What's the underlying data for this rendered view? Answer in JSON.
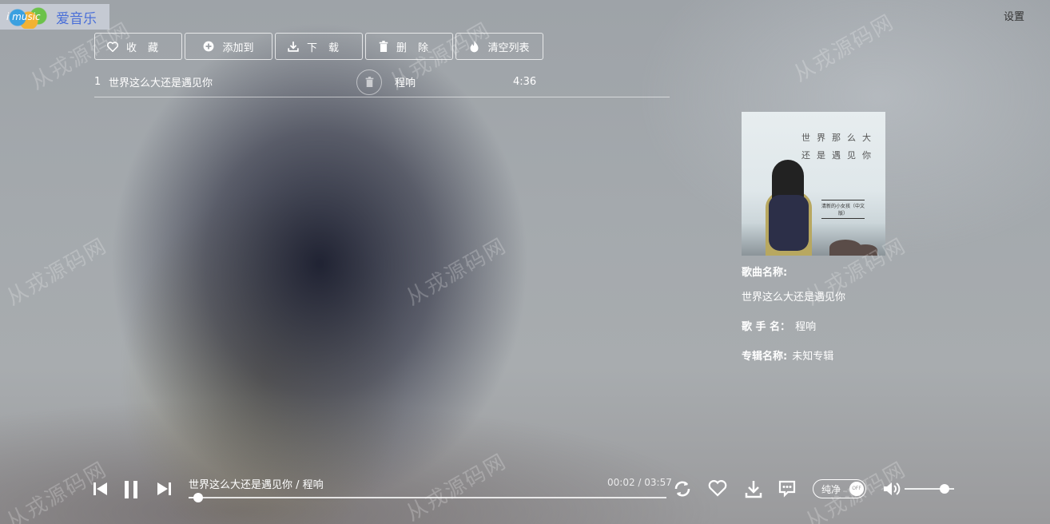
{
  "app": {
    "logo_mark": "i music",
    "logo_text": "爱音乐",
    "settings_label": "设置"
  },
  "toolbar": {
    "favorite_label": "收藏",
    "add_to_label": "添加到",
    "download_label": "下载",
    "delete_label": "删除",
    "clear_label": "清空列表"
  },
  "playlist": {
    "rows": [
      {
        "index": "1",
        "song": "世界这么大还是遇见你",
        "artist": "程响",
        "duration": "4:36"
      }
    ]
  },
  "song_info": {
    "cover_title_line1": "世界那么大",
    "cover_title_line2": "还是遇见你",
    "cover_subtitle": "清新的小女孩（中文版）",
    "name_label": "歌曲名称:",
    "name_value": "世界这么大还是遇见你",
    "artist_label": "歌 手 名：",
    "artist_value": "程响",
    "album_label": "专辑名称:",
    "album_value": "未知专辑"
  },
  "player": {
    "now_playing": "世界这么大还是遇见你 / 程响",
    "time": "00:02 / 03:57",
    "progress_fraction": 0.02,
    "pure_label": "纯净",
    "pure_state": "OFF",
    "volume_fraction": 0.8
  },
  "watermark": "从戎源码网",
  "colors": {
    "accent": "#ffffff",
    "logo_text": "#4a6fd8"
  }
}
